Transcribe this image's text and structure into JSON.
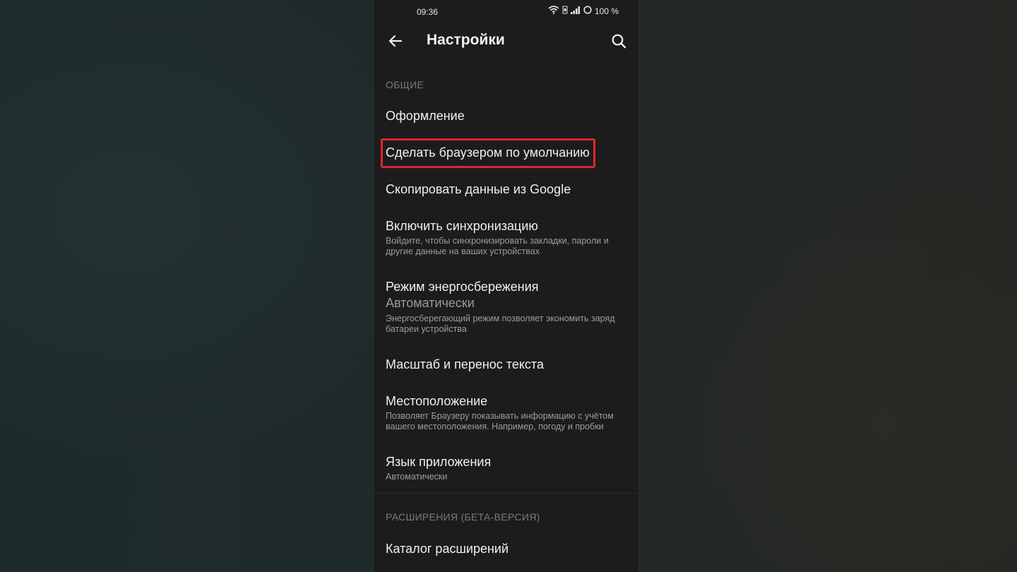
{
  "status": {
    "time": "09:36",
    "battery": "100 %",
    "icons": [
      "wifi-icon",
      "signal-icon",
      "battery-ring-icon"
    ]
  },
  "toolbar": {
    "title": "Настройки",
    "back_icon": "arrow-left-icon",
    "search_icon": "search-icon"
  },
  "sections": {
    "general": {
      "header": "ОБЩИЕ",
      "items": [
        {
          "title": "Оформление"
        },
        {
          "title": "Сделать браузером по умолчанию"
        },
        {
          "title": "Скопировать данные из Google"
        },
        {
          "title": "Включить синхронизацию",
          "subtitle": "Войдите, чтобы синхронизировать закладки, пароли и другие данные на ваших устройствах"
        },
        {
          "title": "Режим энергосбережения",
          "value": "Автоматически",
          "subtitle": "Энергосберегающий режим позволяет экономить заряд батареи устройства"
        },
        {
          "title": "Масштаб и перенос текста"
        },
        {
          "title": "Местоположение",
          "subtitle": "Позволяет Браузеру показывать информацию с учётом вашего местоположения. Например, погоду и пробки"
        },
        {
          "title": "Язык приложения",
          "subtitle": "Автоматически"
        }
      ]
    },
    "extensions": {
      "header": "РАСШИРЕНИЯ (БЕТА-ВЕРСИЯ)",
      "items": [
        {
          "title": "Каталог расширений"
        }
      ]
    }
  },
  "colors": {
    "highlight": "#e0242f",
    "background": "#1c1c1c"
  }
}
